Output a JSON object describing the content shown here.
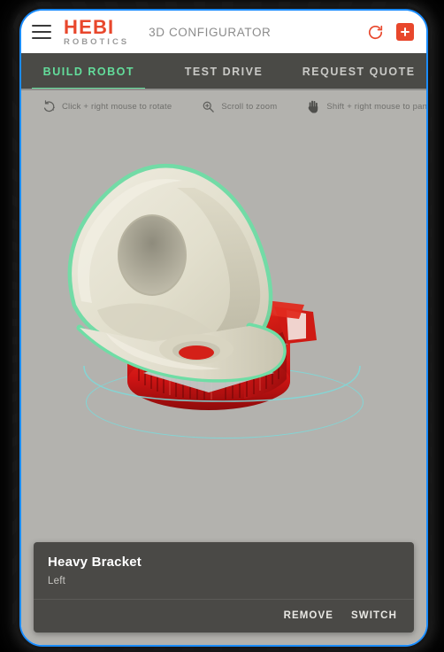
{
  "window": {
    "border_color": "#1a8cff",
    "background": "#000000"
  },
  "topbar": {
    "menu_icon": "hamburger-icon",
    "brand_main": "HEBI",
    "brand_sub": "ROBOTICS",
    "brand_color": "#e8472c",
    "app_title": "3D CONFIGURATOR",
    "reset_icon": "refresh-icon",
    "add_icon": "plus-icon",
    "add_button_color": "#e8472c"
  },
  "tabs": {
    "active_color": "#63dd9b",
    "inactive_color": "#c9c9c6",
    "bar_color": "#4a4a46",
    "items": [
      {
        "label": "BUILD ROBOT",
        "active": true
      },
      {
        "label": "TEST DRIVE",
        "active": false
      },
      {
        "label": "REQUEST QUOTE",
        "active": false
      }
    ]
  },
  "hints": {
    "background": "#b3b2ae",
    "items": [
      {
        "icon": "rotate-icon",
        "label": "Click + right mouse to rotate"
      },
      {
        "icon": "zoom-in-magnifier-icon",
        "label": "Scroll to zoom"
      },
      {
        "icon": "hand-pan-icon",
        "label": "Shift + right mouse to pan"
      }
    ]
  },
  "viewport": {
    "background": "#b3b2ae",
    "orbit_ring_color": "#7fd8d8",
    "selection_outline_color": "#6fdda5",
    "bracket_color": "#e3e0cf",
    "actuator_color": "#d81f1f"
  },
  "info_card": {
    "background": "#4a4946",
    "title": "Heavy Bracket",
    "subtitle": "Left",
    "actions": [
      {
        "label": "REMOVE",
        "name": "remove-button"
      },
      {
        "label": "SWITCH",
        "name": "switch-button"
      }
    ]
  }
}
